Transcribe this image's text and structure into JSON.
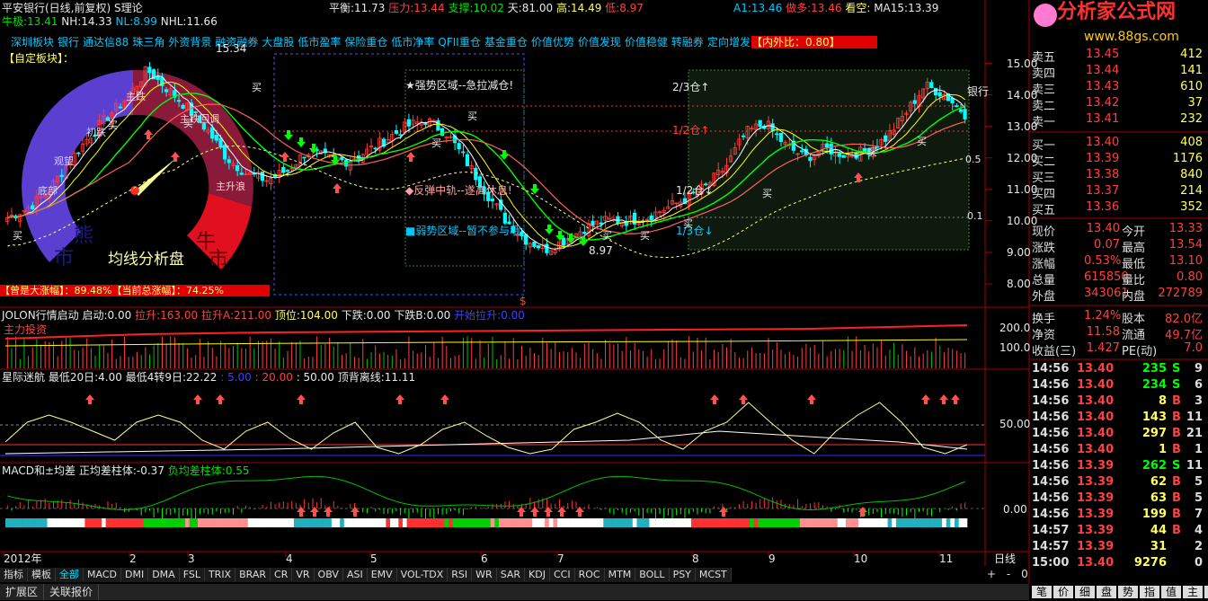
{
  "header": {
    "title": "平安银行(日线,前复权)",
    "formula": "S理论",
    "pingheng_label": "平衡:",
    "pingheng": "11.73",
    "yali_label": "压力:",
    "yali": "13.44",
    "zhicheng_label": "支撑:",
    "zhicheng": "10.02",
    "tian_label": "天:",
    "tian": "81.00",
    "gao_label": "高:",
    "gao": "14.49",
    "di_label": "低:",
    "di": "8.97",
    "a1_label": "A1:",
    "a1": "13.46",
    "zuoduo_label": "做多:",
    "zuoduo": "13.46",
    "kankong_label": "看空:",
    "kankong": "",
    "ma15_label": "MA15:",
    "ma15": "13.39",
    "niuji_label": "牛极:",
    "niuji": "13.41",
    "nh_label": "NH:",
    "nh": "14.33",
    "nl_label": "NL:",
    "nl": "8.99",
    "nhl_label": "NHL:",
    "nhl": "11.66"
  },
  "sectors": [
    "深圳板块",
    "银行",
    "通达信88",
    "珠三角",
    "外资背景",
    "融资融券",
    "大盘股",
    "低市盈率",
    "保险重仓",
    "低市净率",
    "QFII重仓",
    "基金重仓",
    "价值优势",
    "价值发现",
    "价值稳健",
    "转融券",
    "定向增发"
  ],
  "neiwaibi": "【内外比：0.80】",
  "zidingyi": "【自定板块】：",
  "gauge": {
    "title": "均线分析盘",
    "labels": [
      "熊",
      "市",
      "初跌",
      "观望",
      "底部",
      "主跌",
      "牛",
      "市",
      "主升浪",
      "主跌回调"
    ],
    "footer_left": "【曾是大涨幅】：89.48%",
    "footer_right": "【当前总涨幅】：74.25%"
  },
  "annotations": {
    "strong": "★强势区域--急拉减仓!",
    "reb": "◆反弹中轨--遂高休息!",
    "weak": "■弱势区域--暂不参与哦",
    "pos23": "2/3仓↑",
    "pos12a": "1/2仓↑",
    "pos12b": "1/2仓↓",
    "pos13": "1/3仓↓",
    "lowmark": "8.97",
    "highmark": "15.34",
    "yinhang": "银行",
    "dollar": "$"
  },
  "buy_label": "买",
  "price_axis": [
    "15.00",
    "14.00",
    "13.00",
    "12.00",
    "11.00",
    "10.00",
    "9.00",
    "8.00"
  ],
  "osc_axis": [
    "0.5",
    "0.1"
  ],
  "panel2": {
    "title": "JOLON行情启动",
    "qidong_label": "启动:",
    "qidong": "0.00",
    "lasheng_label": "拉升:",
    "lasheng": "163.00",
    "lashenga_label": "拉升A:",
    "lashenga": "211.00",
    "dingwei_label": "顶位:",
    "dingwei": "104.00",
    "xiadie_label": "下跌:",
    "xiadie": "0.00",
    "xiadieb_label": "下跌B:",
    "xiadieb": "0.00",
    "kaishi_label": "开始拉升:",
    "kaishi": "0.00",
    "zhuli": "主力投资",
    "axis": [
      "200.0",
      "100.0"
    ]
  },
  "panel3": {
    "title": "星际迷航",
    "zuidi20_label": "最低20日:",
    "zuidi20": "4.00",
    "zuidi4_label": "最低4转9日:",
    "zuidi4": "22.22",
    "v5": ": 5.00",
    "v20": ": 20.00",
    "v50": ": 50.00",
    "dingbei_label": "顶背离线:",
    "dingbei": "11.11",
    "axis": [
      "50.00"
    ]
  },
  "panel4": {
    "title": "MACD和±均差",
    "zheng_label": "正均差柱体:",
    "zheng": "-0.37",
    "fu_label": "负均差柱体:",
    "fu": "0.55",
    "axis": [
      "0.00"
    ]
  },
  "time_axis": [
    "2012年",
    "2",
    "3",
    "4",
    "5",
    "6",
    "7",
    "8",
    "9",
    "10",
    "11"
  ],
  "rixian": "日线",
  "indicator_tabs": [
    "指标",
    "模板",
    "全部",
    "MACD",
    "DMI",
    "DMA",
    "FSL",
    "TRIX",
    "BRAR",
    "CR",
    "VR",
    "OBV",
    "ASI",
    "EMV",
    "VOL-TDX",
    "RSI",
    "WR",
    "SAR",
    "KDJ",
    "CCI",
    "ROC",
    "MTM",
    "BOLL",
    "PSY",
    "MCST"
  ],
  "bottom_tabs": [
    "扩展区",
    "关联报价"
  ],
  "zoom": [
    "+",
    "-",
    "0"
  ],
  "brand": {
    "name": "分析家公式网",
    "url": "www.88gs.com"
  },
  "sell_book": [
    {
      "label": "卖五",
      "price": "13.45",
      "vol": "412"
    },
    {
      "label": "卖四",
      "price": "13.44",
      "vol": "141"
    },
    {
      "label": "卖三",
      "price": "13.43",
      "vol": "610"
    },
    {
      "label": "卖二",
      "price": "13.42",
      "vol": "37"
    },
    {
      "label": "卖一",
      "price": "13.41",
      "vol": "232"
    }
  ],
  "buy_book": [
    {
      "label": "买一",
      "price": "13.40",
      "vol": "408"
    },
    {
      "label": "买二",
      "price": "13.39",
      "vol": "1176"
    },
    {
      "label": "买三",
      "price": "13.38",
      "vol": "840"
    },
    {
      "label": "买四",
      "price": "13.37",
      "vol": "214"
    },
    {
      "label": "买五",
      "price": "13.36",
      "vol": "352"
    }
  ],
  "stats": [
    {
      "l1": "现价",
      "v1": "13.40",
      "l2": "今开",
      "v2": "13.33"
    },
    {
      "l1": "涨跌",
      "v1": "0.07",
      "l2": "最高",
      "v2": "13.54"
    },
    {
      "l1": "涨幅",
      "v1": "0.53%",
      "l2": "最低",
      "v2": "13.10"
    },
    {
      "l1": "总量",
      "v1": "615850",
      "l2": "量比",
      "v2": "0.80"
    },
    {
      "l1": "外盘",
      "v1": "343061",
      "l2": "内盘",
      "v2": "272789"
    }
  ],
  "fund": [
    {
      "l1": "换手",
      "v1": "1.24%",
      "l2": "股本",
      "v2": "82.0亿"
    },
    {
      "l1": "净资",
      "v1": "11.58",
      "l2": "流通",
      "v2": "49.7亿"
    },
    {
      "l1": "收益(三)",
      "v1": "1.427",
      "l2": "PE(动)",
      "v2": "7.0"
    }
  ],
  "ticks": [
    {
      "t": "14:56",
      "p": "13.40",
      "v": "235",
      "s": "S",
      "n": "9"
    },
    {
      "t": "14:56",
      "p": "13.40",
      "v": "234",
      "s": "S",
      "n": "6"
    },
    {
      "t": "14:56",
      "p": "13.40",
      "v": "8",
      "s": "B",
      "n": "3"
    },
    {
      "t": "14:56",
      "p": "13.40",
      "v": "143",
      "s": "B",
      "n": "11"
    },
    {
      "t": "14:56",
      "p": "13.40",
      "v": "297",
      "s": "B",
      "n": "21"
    },
    {
      "t": "14:56",
      "p": "13.40",
      "v": "1",
      "s": "B",
      "n": "1"
    },
    {
      "t": "14:56",
      "p": "13.39",
      "v": "262",
      "s": "S",
      "n": "11"
    },
    {
      "t": "14:56",
      "p": "13.39",
      "v": "62",
      "s": "B",
      "n": "5"
    },
    {
      "t": "14:56",
      "p": "13.39",
      "v": "63",
      "s": "B",
      "n": "5"
    },
    {
      "t": "14:56",
      "p": "13.39",
      "v": "199",
      "s": "B",
      "n": "7"
    },
    {
      "t": "14:57",
      "p": "13.39",
      "v": "44",
      "s": "B",
      "n": "4"
    },
    {
      "t": "14:57",
      "p": "13.39",
      "v": "31",
      "s": "",
      "n": "2"
    },
    {
      "t": "15:00",
      "p": "13.40",
      "v": "9276",
      "s": "",
      "n": "0"
    }
  ],
  "right_tabs": [
    "笔",
    "价",
    "细",
    "盘",
    "势",
    "指",
    "值",
    "主",
    "筹"
  ],
  "chart_data": {
    "type": "candlestick",
    "title": "平安银行(日线,前复权)",
    "x": [
      "2012-01",
      "2012-02",
      "2012-03",
      "2012-04",
      "2012-05",
      "2012-06",
      "2012-07",
      "2012-08",
      "2012-09",
      "2012-10",
      "2012-11"
    ],
    "ylim": [
      8.0,
      15.3
    ],
    "close_path": [
      10.1,
      10.4,
      10.9,
      11.8,
      12.6,
      13.3,
      13.9,
      14.8,
      14.2,
      13.6,
      12.9,
      12.0,
      11.5,
      11.3,
      11.6,
      12.2,
      12.0,
      11.9,
      12.2,
      12.6,
      13.0,
      13.2,
      12.8,
      11.9,
      10.9,
      10.0,
      9.4,
      9.1,
      9.4,
      9.8,
      10.0,
      10.0,
      10.1,
      10.4,
      10.7,
      11.1,
      11.7,
      12.8,
      13.1,
      12.4,
      12.0,
      12.3,
      12.1,
      12.2,
      12.6,
      13.4,
      14.3,
      14.0,
      13.4
    ],
    "series": [
      {
        "name": "MA15",
        "last": 13.39
      },
      {
        "name": "牛极",
        "last": 13.41
      }
    ],
    "high": 14.49,
    "low": 8.97
  },
  "colors": {
    "up": "#ff3c3c",
    "down": "#00ffff",
    "ma1": "#ffffff",
    "ma2": "#ffff00",
    "ma3": "#00ff00",
    "ma4": "#ff6060",
    "bg": "#000000",
    "grid": "#8b0000"
  }
}
